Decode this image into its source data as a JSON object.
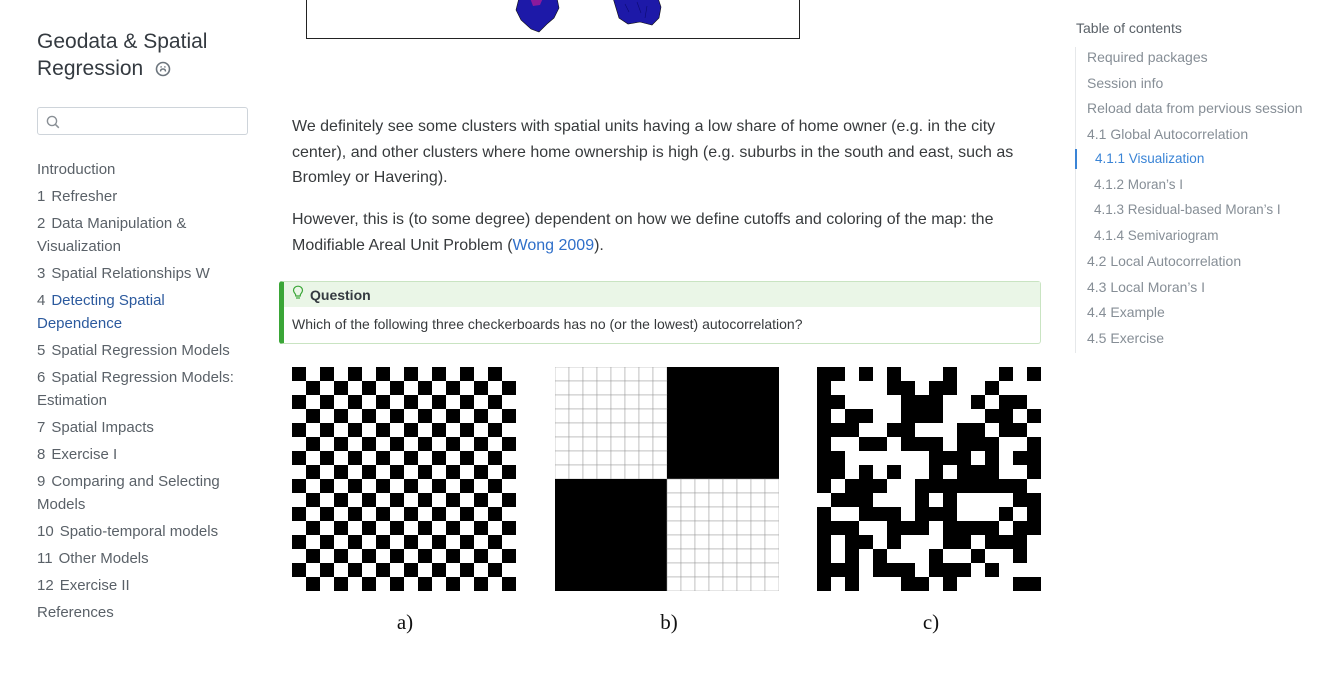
{
  "site": {
    "title": "Geodata & Spatial Regression"
  },
  "search": {
    "placeholder": ""
  },
  "sidebar": {
    "items": [
      {
        "num": "",
        "label": "Introduction"
      },
      {
        "num": "1",
        "label": "Refresher"
      },
      {
        "num": "2",
        "label": "Data Manipulation & Visualization"
      },
      {
        "num": "3",
        "label": "Spatial Relationships W"
      },
      {
        "num": "4",
        "label": "Detecting Spatial Dependence",
        "active": true
      },
      {
        "num": "5",
        "label": "Spatial Regression Models"
      },
      {
        "num": "6",
        "label": "Spatial Regression Models: Estimation"
      },
      {
        "num": "7",
        "label": "Spatial Impacts"
      },
      {
        "num": "8",
        "label": "Exercise I"
      },
      {
        "num": "9",
        "label": "Comparing and Selecting Models"
      },
      {
        "num": "10",
        "label": "Spatio-temporal models"
      },
      {
        "num": "11",
        "label": "Other Models"
      },
      {
        "num": "12",
        "label": "Exercise II"
      },
      {
        "num": "",
        "label": "References"
      }
    ]
  },
  "main": {
    "para1": "We definitely see some clusters with spatial units having a low share of home owner (e.g. in the city center), and other clusters where home ownership is high (e.g. suburbs in the south and east, such as Bromley or Havering).",
    "para2_pre": "However, this is (to some degree) dependent on how we define cutoffs and coloring of the map: the Modifiable Areal Unit Problem (",
    "para2_link": "Wong 2009",
    "para2_post": ").",
    "callout": {
      "title": "Question",
      "body": "Which of the following three checkerboards has no (or the lowest) autocorrelation?"
    },
    "boards": [
      {
        "caption": "a)",
        "pattern": "checker"
      },
      {
        "caption": "b)",
        "pattern": "quadrants"
      },
      {
        "caption": "c)",
        "pattern": "random"
      }
    ]
  },
  "toc": {
    "title": "Table of contents",
    "items": [
      {
        "label": "Required packages",
        "level": 1
      },
      {
        "label": "Session info",
        "level": 1
      },
      {
        "label": "Reload data from pervious session",
        "level": 1
      },
      {
        "label": "4.1 Global Autocorrelation",
        "level": 1
      },
      {
        "label": "4.1.1 Visualization",
        "level": 2,
        "active": true
      },
      {
        "label": "4.1.2 Moran’s I",
        "level": 2
      },
      {
        "label": "4.1.3 Residual-based Moran’s I",
        "level": 2
      },
      {
        "label": "4.1.4 Semivariogram",
        "level": 2
      },
      {
        "label": "4.2 Local Autocorrelation",
        "level": 1
      },
      {
        "label": "4.3 Local Moran’s I",
        "level": 1
      },
      {
        "label": "4.4 Example",
        "level": 1
      },
      {
        "label": "4.5 Exercise",
        "level": 1
      }
    ]
  },
  "colors": {
    "accent": "#2c5a9e",
    "toc_active": "#3a84d6",
    "callout_green": "#3aa637",
    "map_fill": "#1d19a8"
  }
}
